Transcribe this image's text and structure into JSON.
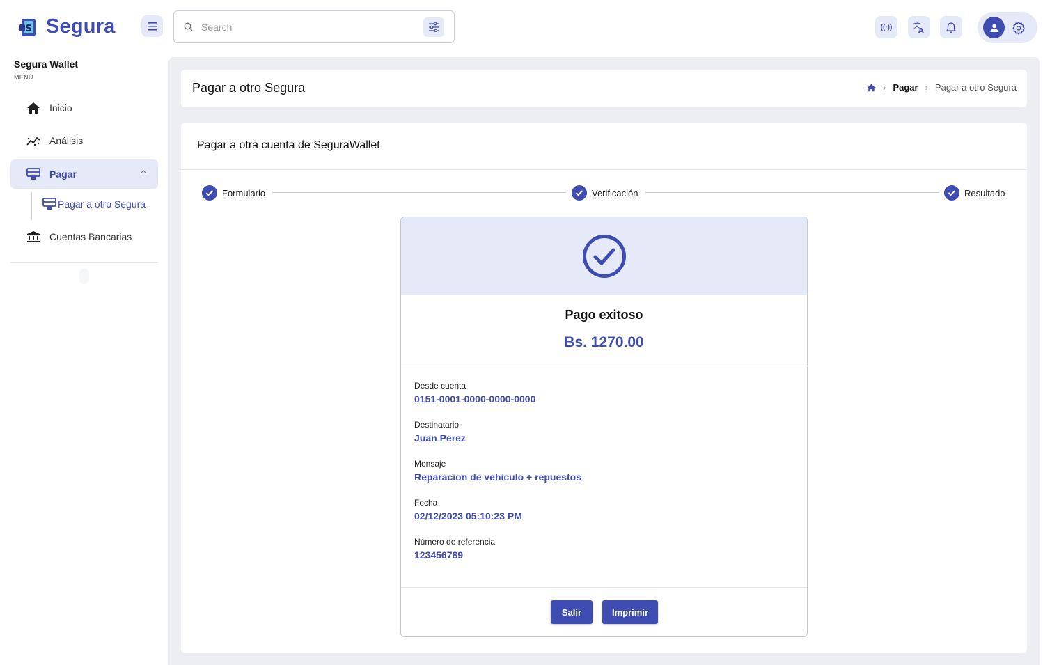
{
  "app": {
    "name": "Segura"
  },
  "header": {
    "search_placeholder": "Search",
    "radio_label": "((·))"
  },
  "sidebar": {
    "title": "Segura Wallet",
    "section_label": "MENÚ",
    "items": [
      {
        "label": "Inicio",
        "icon": "home-icon"
      },
      {
        "label": "Análisis",
        "icon": "analytics-icon"
      },
      {
        "label": "Pagar",
        "icon": "payment-icon"
      },
      {
        "label": "Cuentas Bancarias",
        "icon": "bank-icon"
      }
    ],
    "subitem": {
      "label": "Pagar a otro Segura",
      "icon": "payment-icon"
    }
  },
  "page": {
    "title": "Pagar a otro Segura",
    "breadcrumb": {
      "parent": "Pagar",
      "current": "Pagar a otro Segura"
    }
  },
  "card": {
    "title": "Pagar a otra cuenta de SeguraWallet",
    "steps": [
      "Formulario",
      "Verificación",
      "Resultado"
    ]
  },
  "result": {
    "status": "Pago exitoso",
    "amount": "Bs. 1270.00",
    "details": [
      {
        "label": "Desde cuenta",
        "value": "0151-0001-0000-0000-0000"
      },
      {
        "label": "Destinatario",
        "value": "Juan Perez"
      },
      {
        "label": "Mensaje",
        "value": "Reparacion de vehiculo + repuestos"
      },
      {
        "label": "Fecha",
        "value": "02/12/2023 05:10:23 PM"
      },
      {
        "label": "Número de referencia",
        "value": "123456789"
      }
    ],
    "exit_label": "Salir",
    "print_label": "Imprimir"
  },
  "colors": {
    "accent": "#3f4db3",
    "accent_light": "#e6e9f7",
    "background": "#eceef2"
  }
}
